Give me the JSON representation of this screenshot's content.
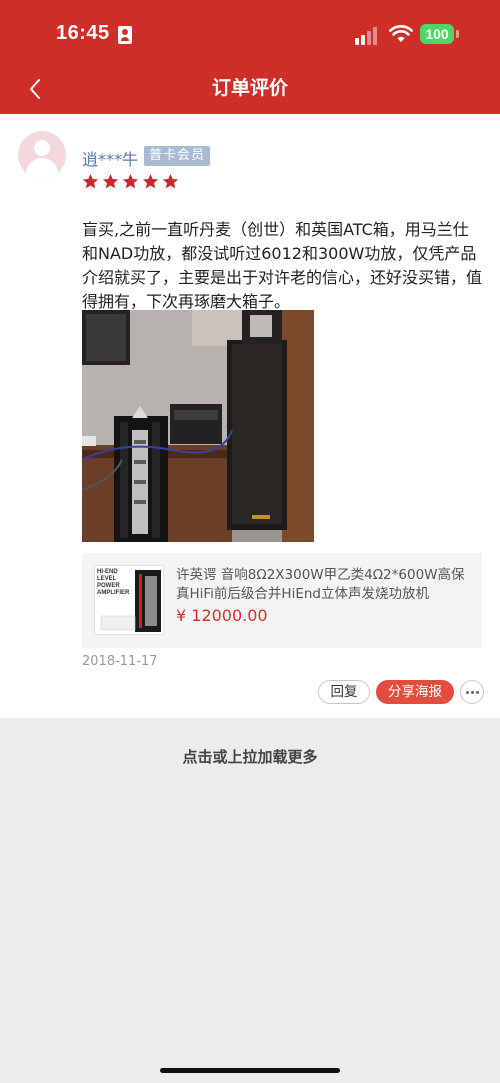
{
  "status_bar": {
    "time": "16:45",
    "battery": "100"
  },
  "nav": {
    "title": "订单评价",
    "back_icon": "chevron-left-icon"
  },
  "review": {
    "username": "逍***牛",
    "member_badge": "普卡会员",
    "rating": 5,
    "rating_max": 5,
    "text": "盲买,之前一直听丹麦（创世）和英国ATC箱，用马兰仕和NAD功放，都没试听过6012和300W功放，仅凭产品介绍就买了，主要是出于对许老的信心，还好没买错，值得拥有，下次再琢磨大箱子。",
    "date": "2018-11-17"
  },
  "product": {
    "name": "许英谔 音响8Ω2X300W甲乙类4Ω2*600W高保真HiFi前后级合并HiEnd立体声发烧功放机",
    "price": "¥ 12000.00",
    "thumb_text": [
      "HI-END",
      "LEVEL",
      "POWER",
      "AMPLIFIER"
    ]
  },
  "actions": {
    "reply": "回复",
    "share": "分享海报",
    "more_icon": "more-dots-icon"
  },
  "footer": {
    "load_more": "点击或上拉加载更多"
  },
  "colors": {
    "header": "#cd2e28",
    "star": "#c8282b",
    "price": "#d3322b",
    "share_button": "#e34c3f",
    "username": "#5a7bb0",
    "badge": "#a9bad4"
  }
}
